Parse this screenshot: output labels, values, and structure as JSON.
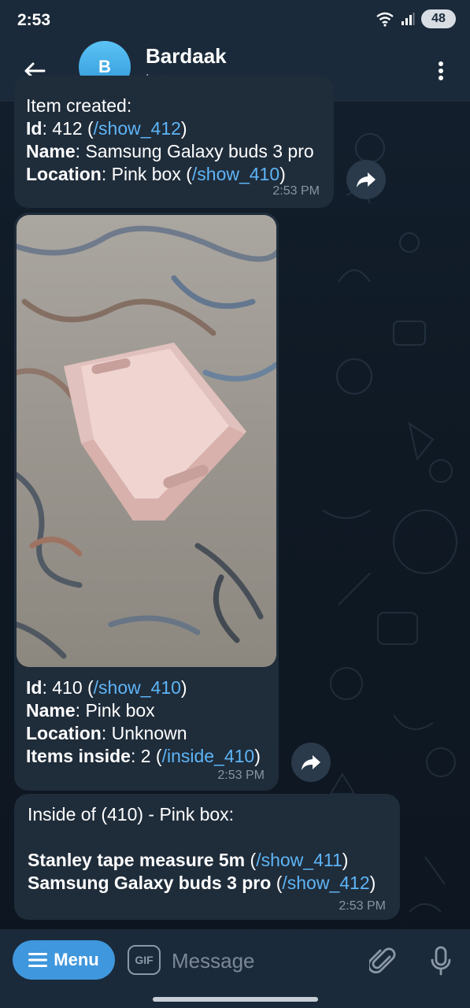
{
  "status_bar": {
    "time": "2:53",
    "battery": "48",
    "icons": [
      "wifi-icon",
      "signal-icon",
      "battery-icon"
    ]
  },
  "header": {
    "avatar_letter": "B",
    "title": "Bardaak",
    "subtitle": "bot",
    "icons": [
      "back-arrow-icon",
      "more-vertical-icon"
    ]
  },
  "messages": [
    {
      "partial_line": "Item created:",
      "lines": [
        {
          "label": "Id",
          "value": "412 (",
          "link": "/show_412",
          "suffix": ")"
        },
        {
          "label": "Name",
          "value": "Samsung Galaxy buds 3 pro",
          "link": "",
          "suffix": ""
        },
        {
          "label": "Location",
          "value": "Pink box (",
          "link": "/show_410",
          "suffix": ")"
        }
      ],
      "time": "2:53 PM"
    },
    {
      "image": "photo of a pink plastic storage box on a patterned rug",
      "lines": [
        {
          "label": "Id",
          "value": "410 (",
          "link": "/show_410",
          "suffix": ")"
        },
        {
          "label": "Name",
          "value": "Pink box",
          "link": "",
          "suffix": ""
        },
        {
          "label": "Location",
          "value": "Unknown",
          "link": "",
          "suffix": ""
        },
        {
          "label": "Items inside",
          "value": "2 (",
          "link": "/inside_410",
          "suffix": ")"
        }
      ],
      "time": "2:53 PM"
    },
    {
      "heading": "Inside of (410) - Pink box:",
      "items": [
        {
          "name": "Stanley tape measure 5m",
          "open": "(",
          "link": "/show_411",
          "close": ")"
        },
        {
          "name": "Samsung Galaxy buds 3 pro",
          "open": "(",
          "link": "/show_412",
          "close": ")"
        }
      ],
      "time": "2:53 PM"
    }
  ],
  "composer": {
    "menu_label": "Menu",
    "gif_label": "GIF",
    "placeholder": "Message",
    "icons": [
      "menu-lines-icon",
      "gif-icon",
      "paperclip-icon",
      "microphone-icon"
    ]
  },
  "colors": {
    "background": "#0f1a26",
    "bar": "#1b2a3a",
    "bubble": "#1f2c3a",
    "link": "#5eb5f7",
    "accent": "#3f97dd"
  }
}
